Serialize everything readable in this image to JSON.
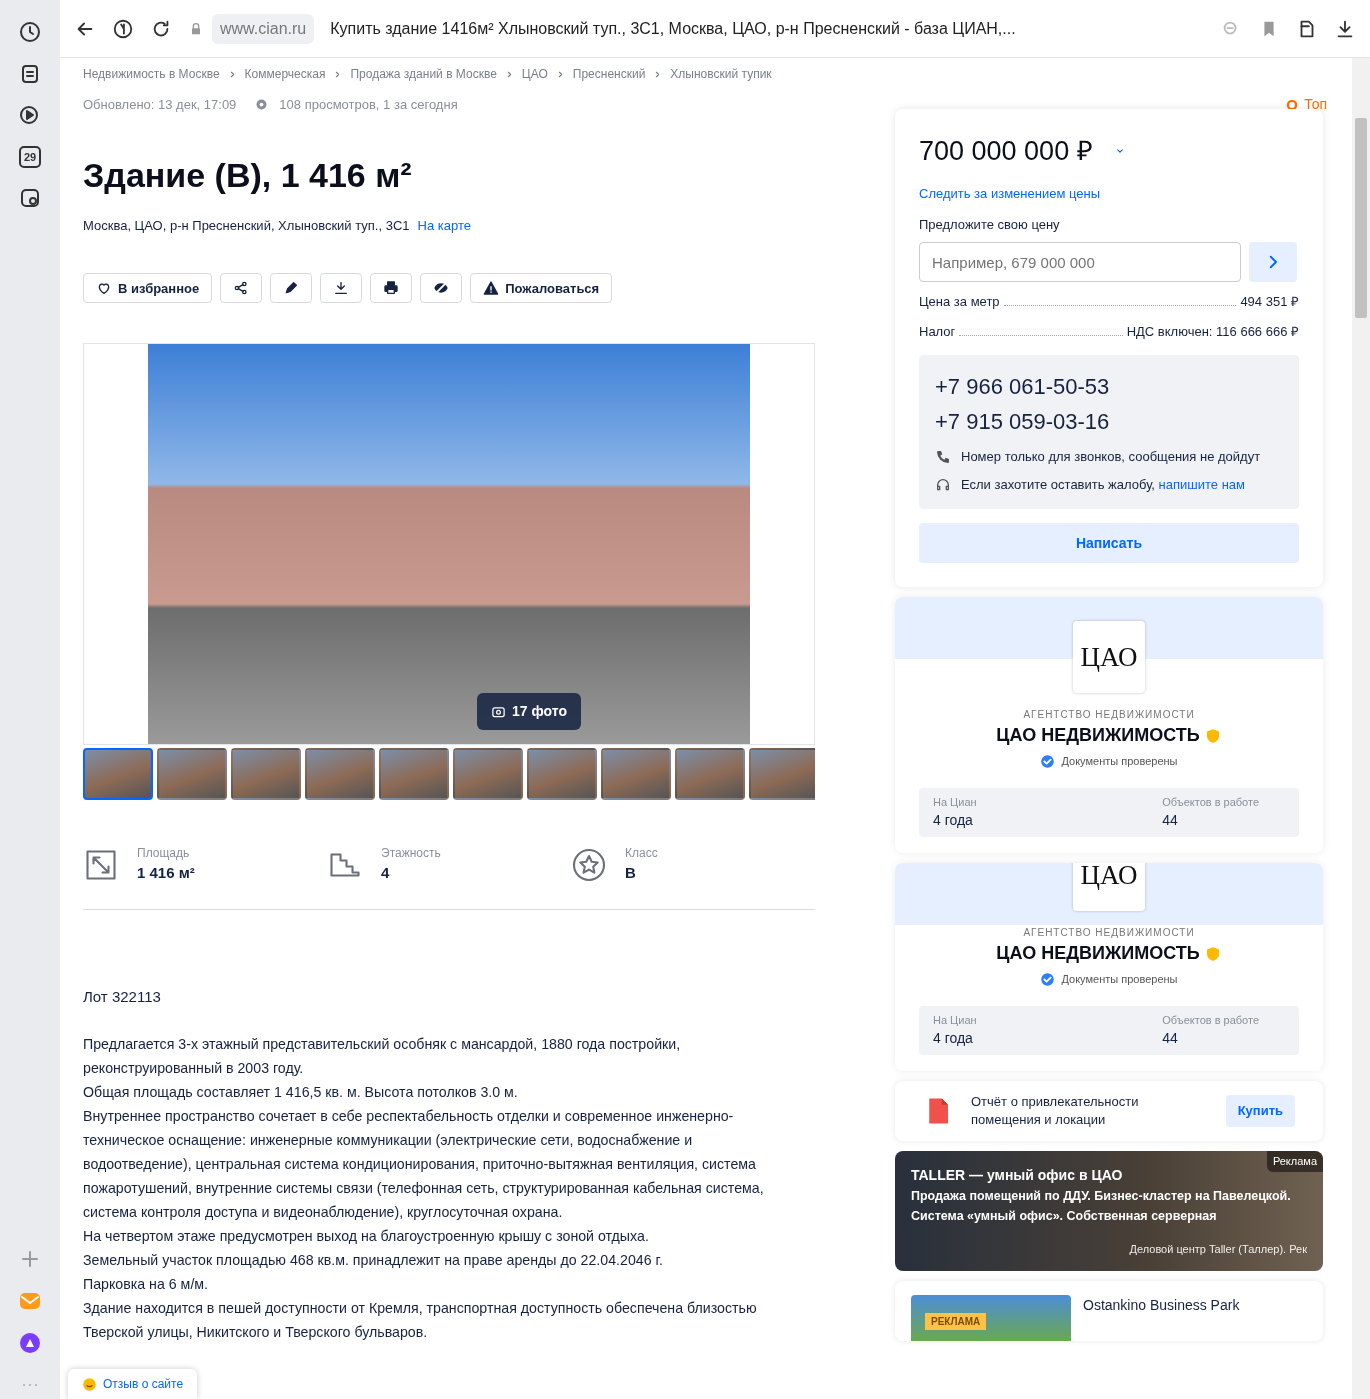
{
  "browser": {
    "url": "www.cian.ru",
    "tab_title": "Купить здание 1416м² Хлыновский туп., 3С1, Москва, ЦАО, р-н Пресненский - база ЦИАН,...",
    "calendar_day": "29"
  },
  "breadcrumbs": [
    "Недвижимость в Москве",
    "Коммерческая",
    "Продажа зданий в Москве",
    "ЦАО",
    "Пресненский",
    "Хлыновский тупик"
  ],
  "updated": "Обновлено: 13 дек, 17:09",
  "views": "108 просмотров, 1 за сегодня",
  "top_badge": "Топ",
  "title": "Здание (В), 1 416 м²",
  "address": "Москва, ЦАО, р-н Пресненский, Хлыновский туп., 3С1",
  "map_link": "На карте",
  "actions": [
    {
      "kind": "favorite",
      "label": "В избранное"
    },
    {
      "kind": "share"
    },
    {
      "kind": "edit"
    },
    {
      "kind": "download"
    },
    {
      "kind": "print"
    },
    {
      "kind": "hide"
    },
    {
      "kind": "report",
      "label": "Пожаловаться"
    }
  ],
  "gallery": {
    "count": "17 фото",
    "thumbnails": [
      {
        "selected": true
      },
      {
        "selected": false
      },
      {
        "selected": false
      },
      {
        "selected": false
      },
      {
        "selected": false
      },
      {
        "selected": false
      },
      {
        "selected": false
      },
      {
        "selected": false
      },
      {
        "selected": false
      },
      {
        "selected": false
      }
    ]
  },
  "features": [
    {
      "kind": "area",
      "label": "Площадь",
      "value": "1 416 м²"
    },
    {
      "kind": "floors",
      "label": "Этажность",
      "value": "4"
    },
    {
      "kind": "class",
      "label": "Класс",
      "value": "B"
    }
  ],
  "lot": "Лот 322113",
  "description": [
    "Предлагается 3-х этажный представительский особняк  с мансардой, 1880 года постройки, реконструированный в 2003 году.",
    "Общая площадь составляет 1 416,5 кв. м. Высота потолков 3.0 м.",
    "Внутреннее пространство сочетает в себе респектабельность отделки и современное инженерно-техническое оснащение: инженерные коммуникации (электрические сети, водоснабжение и водоотведение), центральная  система кондиционирования, приточно-вытяжная вентиляция, система пожаротушений, внутренние системы связи (телефонная сеть, структурированная кабельная система, система контроля доступа и видеонаблюдение), круглосуточная охрана.",
    "На четвертом этаже предусмотрен выход на благоустроенную крышу с зоной отдыха.",
    "Земельный участок площадью 468 кв.м. принадлежит на праве аренды до 22.04.2046 г.",
    "Парковка на 6 м/м.",
    "Здание находится в пешей доступности от Кремля, транспортная доступность обеспечена близостью Тверской улицы, Никитского и Тверского бульваров."
  ],
  "price": {
    "amount": "700 000 000 ₽",
    "track_link": "Следить за изменением цены",
    "offer_label": "Предложите свою цену",
    "offer_placeholder": "Например, 679 000 000",
    "details": [
      {
        "label": "Цена за метр",
        "value": "494 351 ₽"
      },
      {
        "label": "Налог",
        "value": "НДС включен: 116 666 666 ₽"
      }
    ],
    "phones": [
      "+7 966 061-50-53",
      "+7 915 059-03-16"
    ],
    "calls_note": "Номер только для звонков, сообщения не дойдут",
    "complaint_text": "Если захотите оставить жалобу,",
    "complaint_link": "напишите нам",
    "write_button": "Написать"
  },
  "agencies": [
    {
      "logo": "ЦАО",
      "type": "АГЕНТСТВО НЕДВИЖИМОСТИ",
      "name": "ЦАО НЕДВИЖИМОСТЬ",
      "verified": "Документы проверены",
      "stats": [
        {
          "label": "На Циан",
          "value": "4 года"
        },
        {
          "label": "Объектов в работе",
          "value": "44"
        }
      ]
    },
    {
      "logo": "ЦАО",
      "type": "АГЕНТСТВО НЕДВИЖИМОСТИ",
      "name": "ЦАО НЕДВИЖИМОСТЬ",
      "verified": "Документы проверены",
      "stats": [
        {
          "label": "На Циан",
          "value": "4 года"
        },
        {
          "label": "Объектов в работе",
          "value": "44"
        }
      ]
    }
  ],
  "report": {
    "text": "Отчёт о привлекательности помещения и локации",
    "button": "Купить"
  },
  "ads": [
    {
      "kind": "banner",
      "badge": "Реклама",
      "title": "TALLER — умный офис в ЦАО",
      "text": "Продажа помещений по ДДУ. Бизнес-кластер на Павелецкой. Система «умный офис». Собственная серверная",
      "source": "Деловой центр Taller (Таллер). Рек"
    },
    {
      "kind": "card",
      "badge": "РЕКЛАМА",
      "title": "Ostankino Business Park"
    }
  ],
  "feedback": "Отзыв о сайте"
}
